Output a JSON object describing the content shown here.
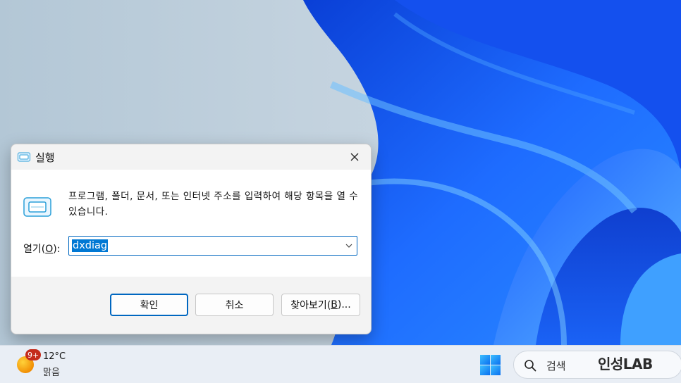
{
  "run_dialog": {
    "title": "실행",
    "description": "프로그램, 폴더, 문서, 또는 인터넷 주소를 입력하여 해당 항목을 열 수 있습니다.",
    "open_label_prefix": "열기(",
    "open_label_key": "O",
    "open_label_suffix": "):",
    "command_value": "dxdiag",
    "buttons": {
      "ok": "확인",
      "cancel": "취소",
      "browse_prefix": "찾아보기(",
      "browse_key": "B",
      "browse_suffix": ")..."
    }
  },
  "taskbar": {
    "weather": {
      "badge": "9+",
      "temperature": "12°C",
      "condition": "맑음"
    },
    "search_placeholder": "검색",
    "watermark_text": "인성LAB"
  },
  "colors": {
    "accent": "#0067c0",
    "selection": "#0078d4",
    "badge": "#c42b1c",
    "wallpaper_blue": "#1f6fff"
  }
}
